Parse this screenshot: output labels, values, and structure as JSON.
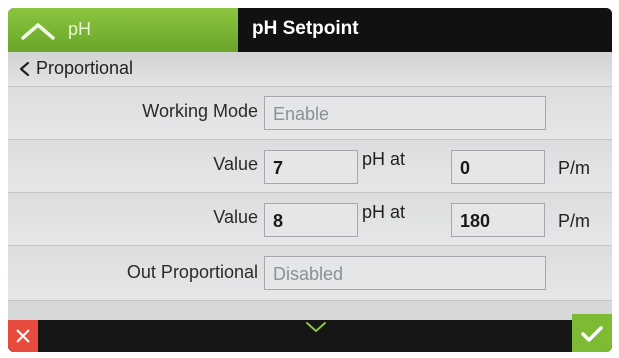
{
  "header": {
    "back_tab_label": "pH",
    "title": "pH Setpoint"
  },
  "breadcrumb": {
    "label": "Proportional"
  },
  "rows": {
    "working_mode": {
      "label": "Working Mode",
      "value": "Enable"
    },
    "value_1": {
      "label": "Value",
      "ph": "7",
      "unit_ph": "pH at",
      "rate": "0",
      "unit_rate": "P/m"
    },
    "value_2": {
      "label": "Value",
      "ph": "8",
      "unit_ph": "pH at",
      "rate": "180",
      "unit_rate": "P/m"
    },
    "out_proportional": {
      "label": "Out Proportional",
      "value": "Disabled"
    }
  },
  "footer": {
    "icons": [
      "close-icon",
      "chevron-down-icon",
      "check-icon"
    ]
  },
  "colors": {
    "accent_green": "#7dbb34",
    "cancel_red": "#e84b3c",
    "header_dark": "#111111",
    "content_bg": "#d7d8da"
  }
}
